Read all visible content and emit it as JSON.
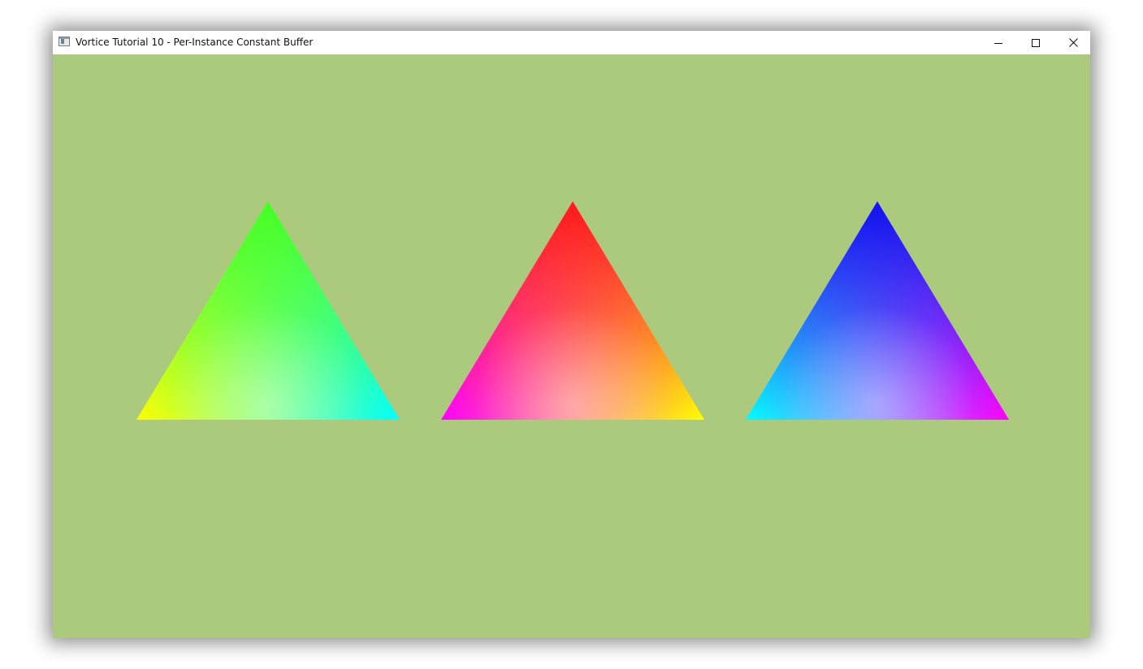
{
  "window": {
    "title": "Vortice Tutorial 10 - Per-Instance Constant Buffer",
    "icon": "app-window-icon",
    "caption_buttons": [
      {
        "name": "minimize-button",
        "icon": "minimize-icon"
      },
      {
        "name": "maximize-button",
        "icon": "maximize-icon"
      },
      {
        "name": "close-button",
        "icon": "close-icon"
      }
    ]
  },
  "scene": {
    "clear_color": "#abca7d",
    "triangles": [
      {
        "name": "triangle-green",
        "top": "#44ff22",
        "left": "#ffff00",
        "right": "#00ffff"
      },
      {
        "name": "triangle-red",
        "top": "#ff1a1a",
        "left": "#ff00ff",
        "right": "#ffff00"
      },
      {
        "name": "triangle-blue",
        "top": "#1111ee",
        "left": "#00ffff",
        "right": "#ff00ff"
      }
    ]
  }
}
